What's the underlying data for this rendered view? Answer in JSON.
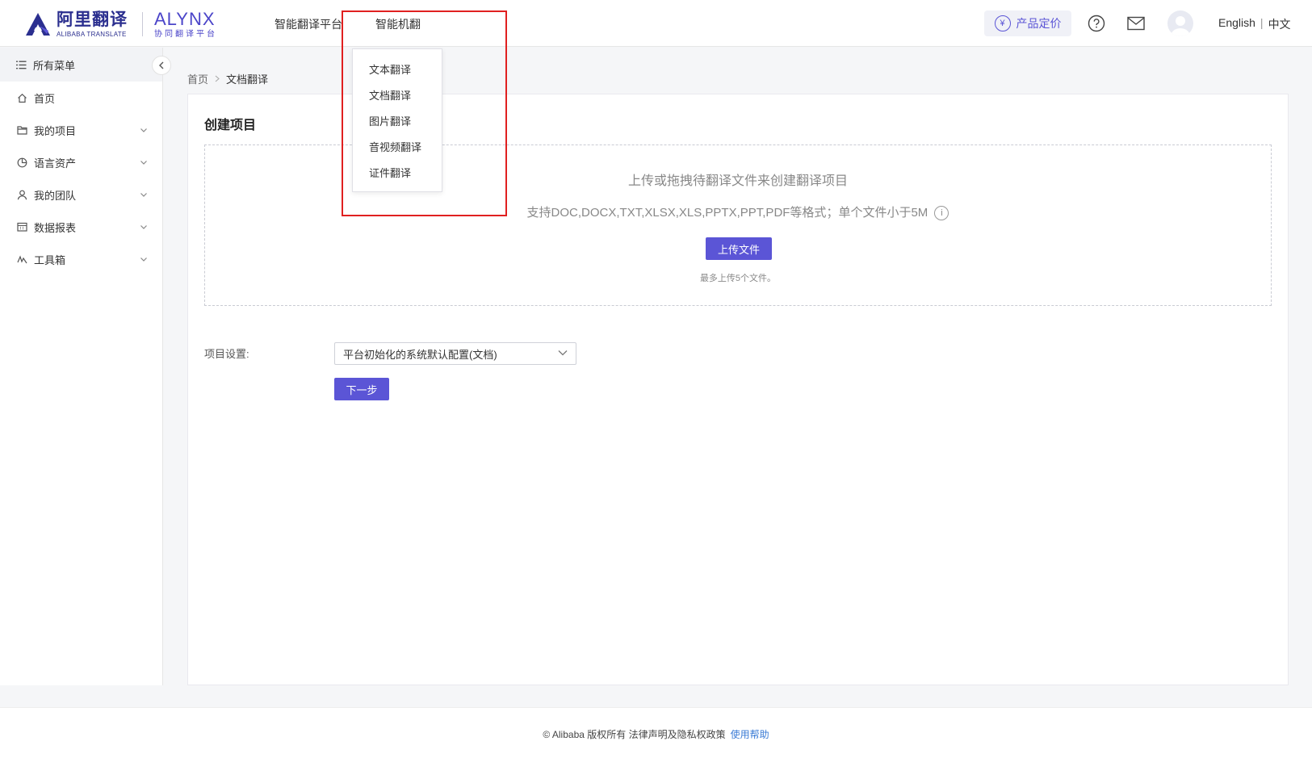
{
  "header": {
    "logo_cn": "阿里翻译",
    "logo_en": "ALIBABA TRANSLATE",
    "brand_name": "ALYNX",
    "brand_sub": "协同翻译平台",
    "nav": [
      {
        "label": "智能翻译平台"
      },
      {
        "label": "智能机翻"
      }
    ],
    "pricing_label": "产品定价",
    "lang_en": "English",
    "lang_sep": "|",
    "lang_cn": "中文"
  },
  "sidebar": {
    "head_label": "所有菜单",
    "items": [
      {
        "label": "首页",
        "icon": "home-icon",
        "has_children": false
      },
      {
        "label": "我的项目",
        "icon": "folder-icon",
        "has_children": true
      },
      {
        "label": "语言资产",
        "icon": "pie-icon",
        "has_children": true
      },
      {
        "label": "我的团队",
        "icon": "user-icon",
        "has_children": true
      },
      {
        "label": "数据报表",
        "icon": "calendar-icon",
        "has_children": true
      },
      {
        "label": "工具箱",
        "icon": "tool-icon",
        "has_children": true
      }
    ]
  },
  "breadcrumb": {
    "home": "首页",
    "separator": ">",
    "current": "文档翻译"
  },
  "main": {
    "title": "创建项目",
    "dropzone_line1": "上传或拖拽待翻译文件来创建翻译项目",
    "dropzone_line2": "支持DOC,DOCX,TXT,XLSX,XLS,PPTX,PPT,PDF等格式；单个文件小于5M",
    "upload_label": "上传文件",
    "upload_hint": "最多上传5个文件。",
    "setting_label": "项目设置:",
    "setting_value": "平台初始化的系统默认配置(文档)",
    "next_label": "下一步"
  },
  "dropdown": {
    "items": [
      "文本翻译",
      "文档翻译",
      "图片翻译",
      "音视频翻译",
      "证件翻译"
    ]
  },
  "footer": {
    "copyright": "© Alibaba 版权所有 法律声明及隐私权政策",
    "help": "使用帮助"
  },
  "colors": {
    "accent": "#5b55d6",
    "highlight": "#e02020",
    "link": "#3a7bd5"
  }
}
